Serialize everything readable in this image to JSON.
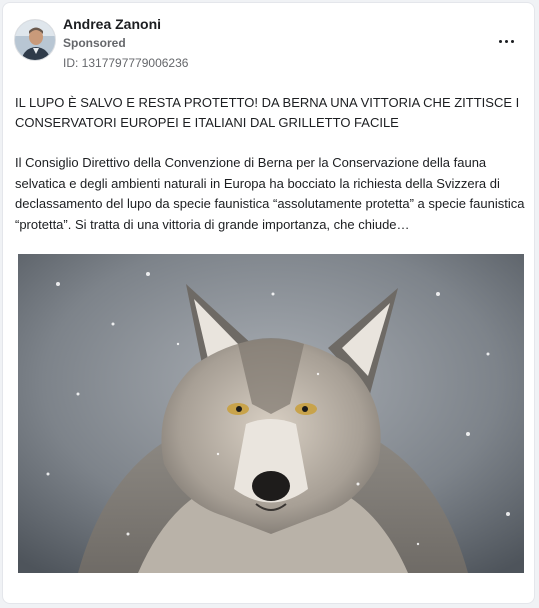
{
  "post": {
    "author": "Andrea Zanoni",
    "sponsored_label": "Sponsored",
    "ad_id": "ID: 1317797779006236",
    "more_icon": "more-horizontal-icon",
    "headline": "IL LUPO È SALVO E RESTA PROTETTO! DA BERNA UNA VITTORIA CHE ZITTISCE I CONSERVATORI EUROPEI E ITALIANI DAL GRILLETTO FACILE",
    "body": "Il Consiglio Direttivo della Convenzione di Berna per la Conservazione della fauna selvatica e degli ambienti naturali in Europa ha bocciato la richiesta della Svizzera di declassamento del lupo da specie faunistica “assolutamente protetta” a specie faunistica “protetta”. Si tratta di una vittoria di grande importanza, che chiude…"
  },
  "colors": {
    "text": "#1c1e21",
    "secondary_text": "#65676b",
    "card_background": "#ffffff",
    "page_background": "#f0f2f5"
  }
}
